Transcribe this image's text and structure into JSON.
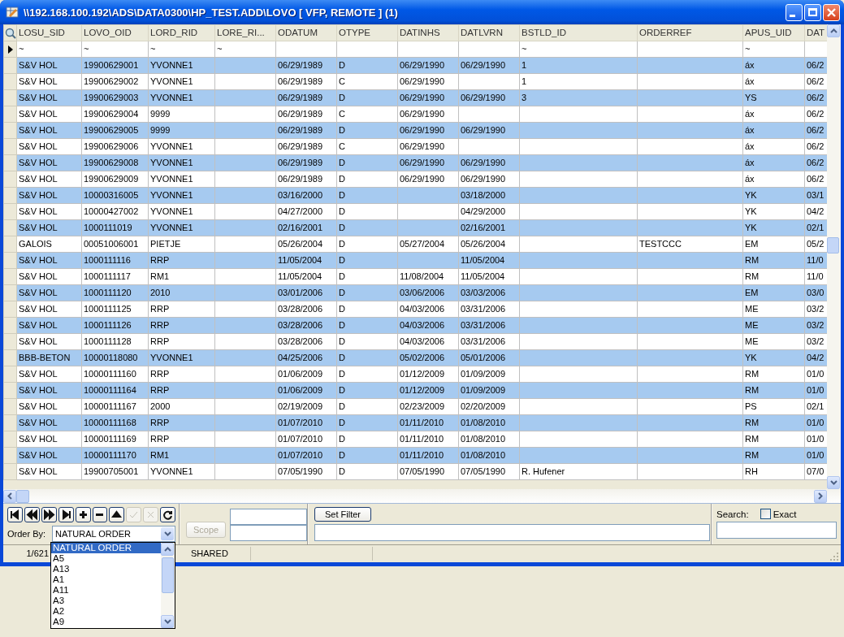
{
  "window": {
    "title": "\\\\192.168.100.192\\ADS\\DATA0300\\HP_TEST.ADD\\LOVO [ VFP, REMOTE ] (1)"
  },
  "grid": {
    "columns": [
      {
        "label": "LOSU_SID",
        "filter": "~"
      },
      {
        "label": "LOVO_OID",
        "filter": "~"
      },
      {
        "label": "LORD_RID",
        "filter": "~"
      },
      {
        "label": "LORE_RI...",
        "filter": "~"
      },
      {
        "label": "ODATUM"
      },
      {
        "label": "OTYPE"
      },
      {
        "label": "DATINHS"
      },
      {
        "label": "DATLVRN"
      },
      {
        "label": "BSTLD_ID",
        "filter": "~"
      },
      {
        "label": "ORDERREF"
      },
      {
        "label": "APUS_UID",
        "filter": "~"
      },
      {
        "label": "DAT"
      }
    ],
    "rows": [
      {
        "cells": [
          "S&V HOL",
          "19900629001",
          "YVONNE1",
          null,
          "06/29/1989",
          "D",
          "06/29/1990",
          "06/29/1990",
          "1",
          null,
          "áx",
          "06/2"
        ]
      },
      {
        "cells": [
          "S&V HOL",
          "19900629002",
          "YVONNE1",
          null,
          "06/29/1989",
          "C",
          "06/29/1990",
          null,
          "1",
          null,
          "áx",
          "06/2"
        ]
      },
      {
        "cells": [
          "S&V HOL",
          "19900629003",
          "YVONNE1",
          null,
          "06/29/1989",
          "D",
          "06/29/1990",
          "06/29/1990",
          "3",
          null,
          "YS",
          "06/2"
        ]
      },
      {
        "cells": [
          "S&V HOL",
          "19900629004",
          "9999",
          null,
          "06/29/1989",
          "C",
          "06/29/1990",
          null,
          null,
          null,
          "áx",
          "06/2"
        ]
      },
      {
        "cells": [
          "S&V HOL",
          "19900629005",
          "9999",
          null,
          "06/29/1989",
          "D",
          "06/29/1990",
          "06/29/1990",
          null,
          null,
          "áx",
          "06/2"
        ]
      },
      {
        "cells": [
          "S&V HOL",
          "19900629006",
          "YVONNE1",
          null,
          "06/29/1989",
          "C",
          "06/29/1990",
          null,
          null,
          null,
          "áx",
          "06/2"
        ]
      },
      {
        "cells": [
          "S&V HOL",
          "19900629008",
          "YVONNE1",
          null,
          "06/29/1989",
          "D",
          "06/29/1990",
          "06/29/1990",
          null,
          null,
          "áx",
          "06/2"
        ]
      },
      {
        "cells": [
          "S&V HOL",
          "19900629009",
          "YVONNE1",
          null,
          "06/29/1989",
          "D",
          "06/29/1990",
          "06/29/1990",
          null,
          null,
          "áx",
          "06/2"
        ]
      },
      {
        "cells": [
          "S&V HOL",
          "10000316005",
          "YVONNE1",
          null,
          "03/16/2000",
          "D",
          null,
          "03/18/2000",
          null,
          null,
          "YK",
          "03/1"
        ]
      },
      {
        "cells": [
          "S&V HOL",
          "10000427002",
          "YVONNE1",
          null,
          "04/27/2000",
          "D",
          null,
          "04/29/2000",
          null,
          null,
          "YK",
          "04/2"
        ]
      },
      {
        "cells": [
          "S&V HOL",
          "1000111019",
          "YVONNE1",
          null,
          "02/16/2001",
          "D",
          null,
          "02/16/2001",
          null,
          null,
          "YK",
          "02/1"
        ]
      },
      {
        "cells": [
          "GALOIS",
          "00051006001",
          "PIETJE",
          null,
          "05/26/2004",
          "D",
          "05/27/2004",
          "05/26/2004",
          null,
          "TESTCCC",
          "EM",
          "05/2"
        ]
      },
      {
        "cells": [
          "S&V HOL",
          "1000111116",
          "RRP",
          null,
          "11/05/2004",
          "D",
          null,
          "11/05/2004",
          null,
          null,
          "RM",
          "11/0"
        ]
      },
      {
        "cells": [
          "S&V HOL",
          "1000111117",
          "RM1",
          null,
          "11/05/2004",
          "D",
          "11/08/2004",
          "11/05/2004",
          null,
          null,
          "RM",
          "11/0"
        ]
      },
      {
        "cells": [
          "S&V HOL",
          "1000111120",
          "2010",
          null,
          "03/01/2006",
          "D",
          "03/06/2006",
          "03/03/2006",
          null,
          null,
          "EM",
          "03/0"
        ]
      },
      {
        "cells": [
          "S&V HOL",
          "1000111125",
          "RRP",
          null,
          "03/28/2006",
          "D",
          "04/03/2006",
          "03/31/2006",
          null,
          null,
          "ME",
          "03/2"
        ]
      },
      {
        "cells": [
          "S&V HOL",
          "1000111126",
          "RRP",
          null,
          "03/28/2006",
          "D",
          "04/03/2006",
          "03/31/2006",
          null,
          null,
          "ME",
          "03/2"
        ]
      },
      {
        "cells": [
          "S&V HOL",
          "1000111128",
          "RRP",
          null,
          "03/28/2006",
          "D",
          "04/03/2006",
          "03/31/2006",
          null,
          null,
          "ME",
          "03/2"
        ]
      },
      {
        "cells": [
          "BBB-BETON",
          "10000118080",
          "YVONNE1",
          null,
          "04/25/2006",
          "D",
          "05/02/2006",
          "05/01/2006",
          null,
          null,
          "YK",
          "04/2"
        ]
      },
      {
        "cells": [
          "S&V HOL",
          "10000111160",
          "RRP",
          null,
          "01/06/2009",
          "D",
          "01/12/2009",
          "01/09/2009",
          null,
          null,
          "RM",
          "01/0"
        ]
      },
      {
        "cells": [
          "S&V HOL",
          "10000111164",
          "RRP",
          null,
          "01/06/2009",
          "D",
          "01/12/2009",
          "01/09/2009",
          null,
          null,
          "RM",
          "01/0"
        ]
      },
      {
        "cells": [
          "S&V HOL",
          "10000111167",
          "2000",
          null,
          "02/19/2009",
          "D",
          "02/23/2009",
          "02/20/2009",
          null,
          null,
          "PS",
          "02/1"
        ]
      },
      {
        "cells": [
          "S&V HOL",
          "10000111168",
          "RRP",
          null,
          "01/07/2010",
          "D",
          "01/11/2010",
          "01/08/2010",
          null,
          null,
          "RM",
          "01/0"
        ]
      },
      {
        "cells": [
          "S&V HOL",
          "10000111169",
          "RRP",
          null,
          "01/07/2010",
          "D",
          "01/11/2010",
          "01/08/2010",
          null,
          null,
          "RM",
          "01/0"
        ]
      },
      {
        "cells": [
          "S&V HOL",
          "10000111170",
          "RM1",
          null,
          "01/07/2010",
          "D",
          "01/11/2010",
          "01/08/2010",
          null,
          null,
          "RM",
          "01/0"
        ]
      },
      {
        "cells": [
          "S&V HOL",
          "19900705001",
          "YVONNE1",
          null,
          "07/05/1990",
          "D",
          "07/05/1990",
          "07/05/1990",
          "R. Hufener",
          null,
          "RH",
          "07/0"
        ]
      }
    ]
  },
  "nav_buttons": [
    {
      "kind": "first",
      "disabled": false
    },
    {
      "kind": "prev",
      "disabled": false
    },
    {
      "kind": "next",
      "disabled": false
    },
    {
      "kind": "last",
      "disabled": false
    },
    {
      "kind": "add",
      "disabled": false
    },
    {
      "kind": "remove",
      "disabled": false
    },
    {
      "kind": "up",
      "disabled": false
    },
    {
      "kind": "confirm",
      "disabled": true
    },
    {
      "kind": "cancel",
      "disabled": true
    },
    {
      "kind": "refresh",
      "disabled": false
    }
  ],
  "order_by": {
    "label": "Order By:",
    "value": "NATURAL ORDER",
    "expanded": true,
    "options": [
      {
        "label": "NATURAL ORDER",
        "selected": true
      },
      {
        "label": "A5",
        "selected": false
      },
      {
        "label": "A13",
        "selected": false
      },
      {
        "label": "A1",
        "selected": false
      },
      {
        "label": "A11",
        "selected": false
      },
      {
        "label": "A3",
        "selected": false
      },
      {
        "label": "A2",
        "selected": false
      },
      {
        "label": "A9",
        "selected": false
      }
    ]
  },
  "scope": {
    "label": "Scope",
    "disabled": true
  },
  "filter": {
    "button": "Set Filter"
  },
  "search": {
    "label": "Search:",
    "exact": {
      "label": "Exact",
      "checked": false
    }
  },
  "status_bar": {
    "record": "1/621",
    "mode": "SHARED"
  }
}
